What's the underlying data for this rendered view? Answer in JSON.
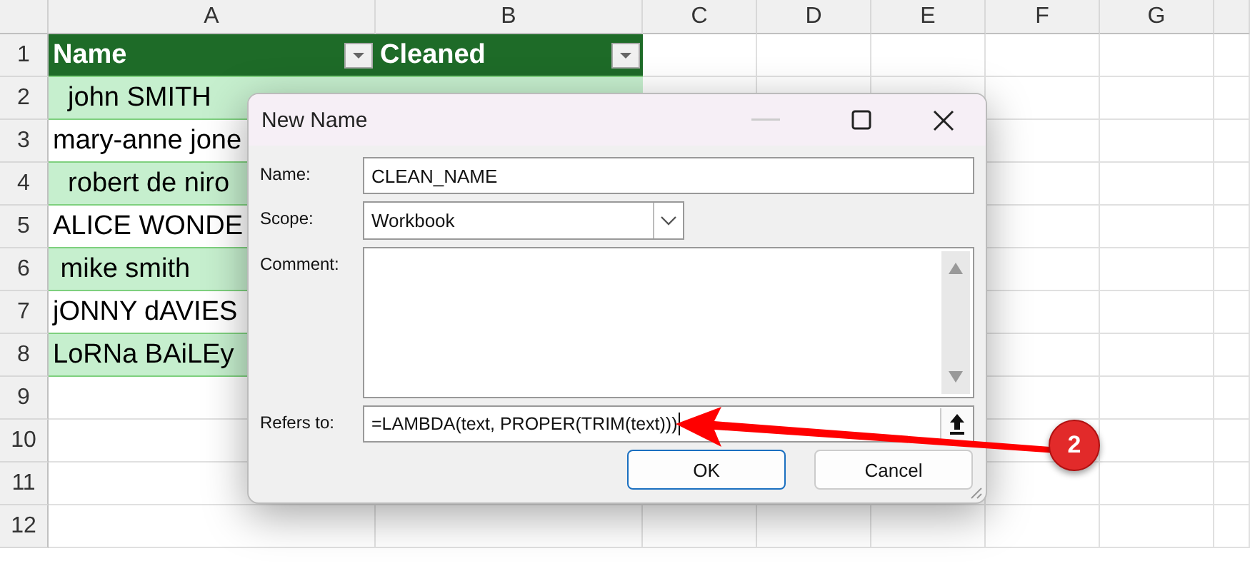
{
  "sheet": {
    "columns": [
      "A",
      "B",
      "C",
      "D",
      "E",
      "F",
      "G"
    ],
    "row_numbers": [
      "1",
      "2",
      "3",
      "4",
      "5",
      "6",
      "7",
      "8",
      "9",
      "10",
      "11",
      "12"
    ],
    "headers": [
      "Name",
      "Cleaned"
    ],
    "cells": [
      "  john SMITH",
      "mary-anne jone",
      "  robert de niro",
      "ALICE WONDE",
      " mike smith",
      "jONNY dAVIES",
      "LoRNa BAiLEy"
    ]
  },
  "dialog": {
    "title": "New Name",
    "name_label": "Name:",
    "name_value": "CLEAN_NAME",
    "scope_label": "Scope:",
    "scope_value": "Workbook",
    "comment_label": "Comment:",
    "refers_label": "Refers to:",
    "refers_value": "=LAMBDA(text, PROPER(TRIM(text)))",
    "buttons": [
      "OK",
      "Cancel"
    ]
  },
  "callout": {
    "number": "2"
  }
}
